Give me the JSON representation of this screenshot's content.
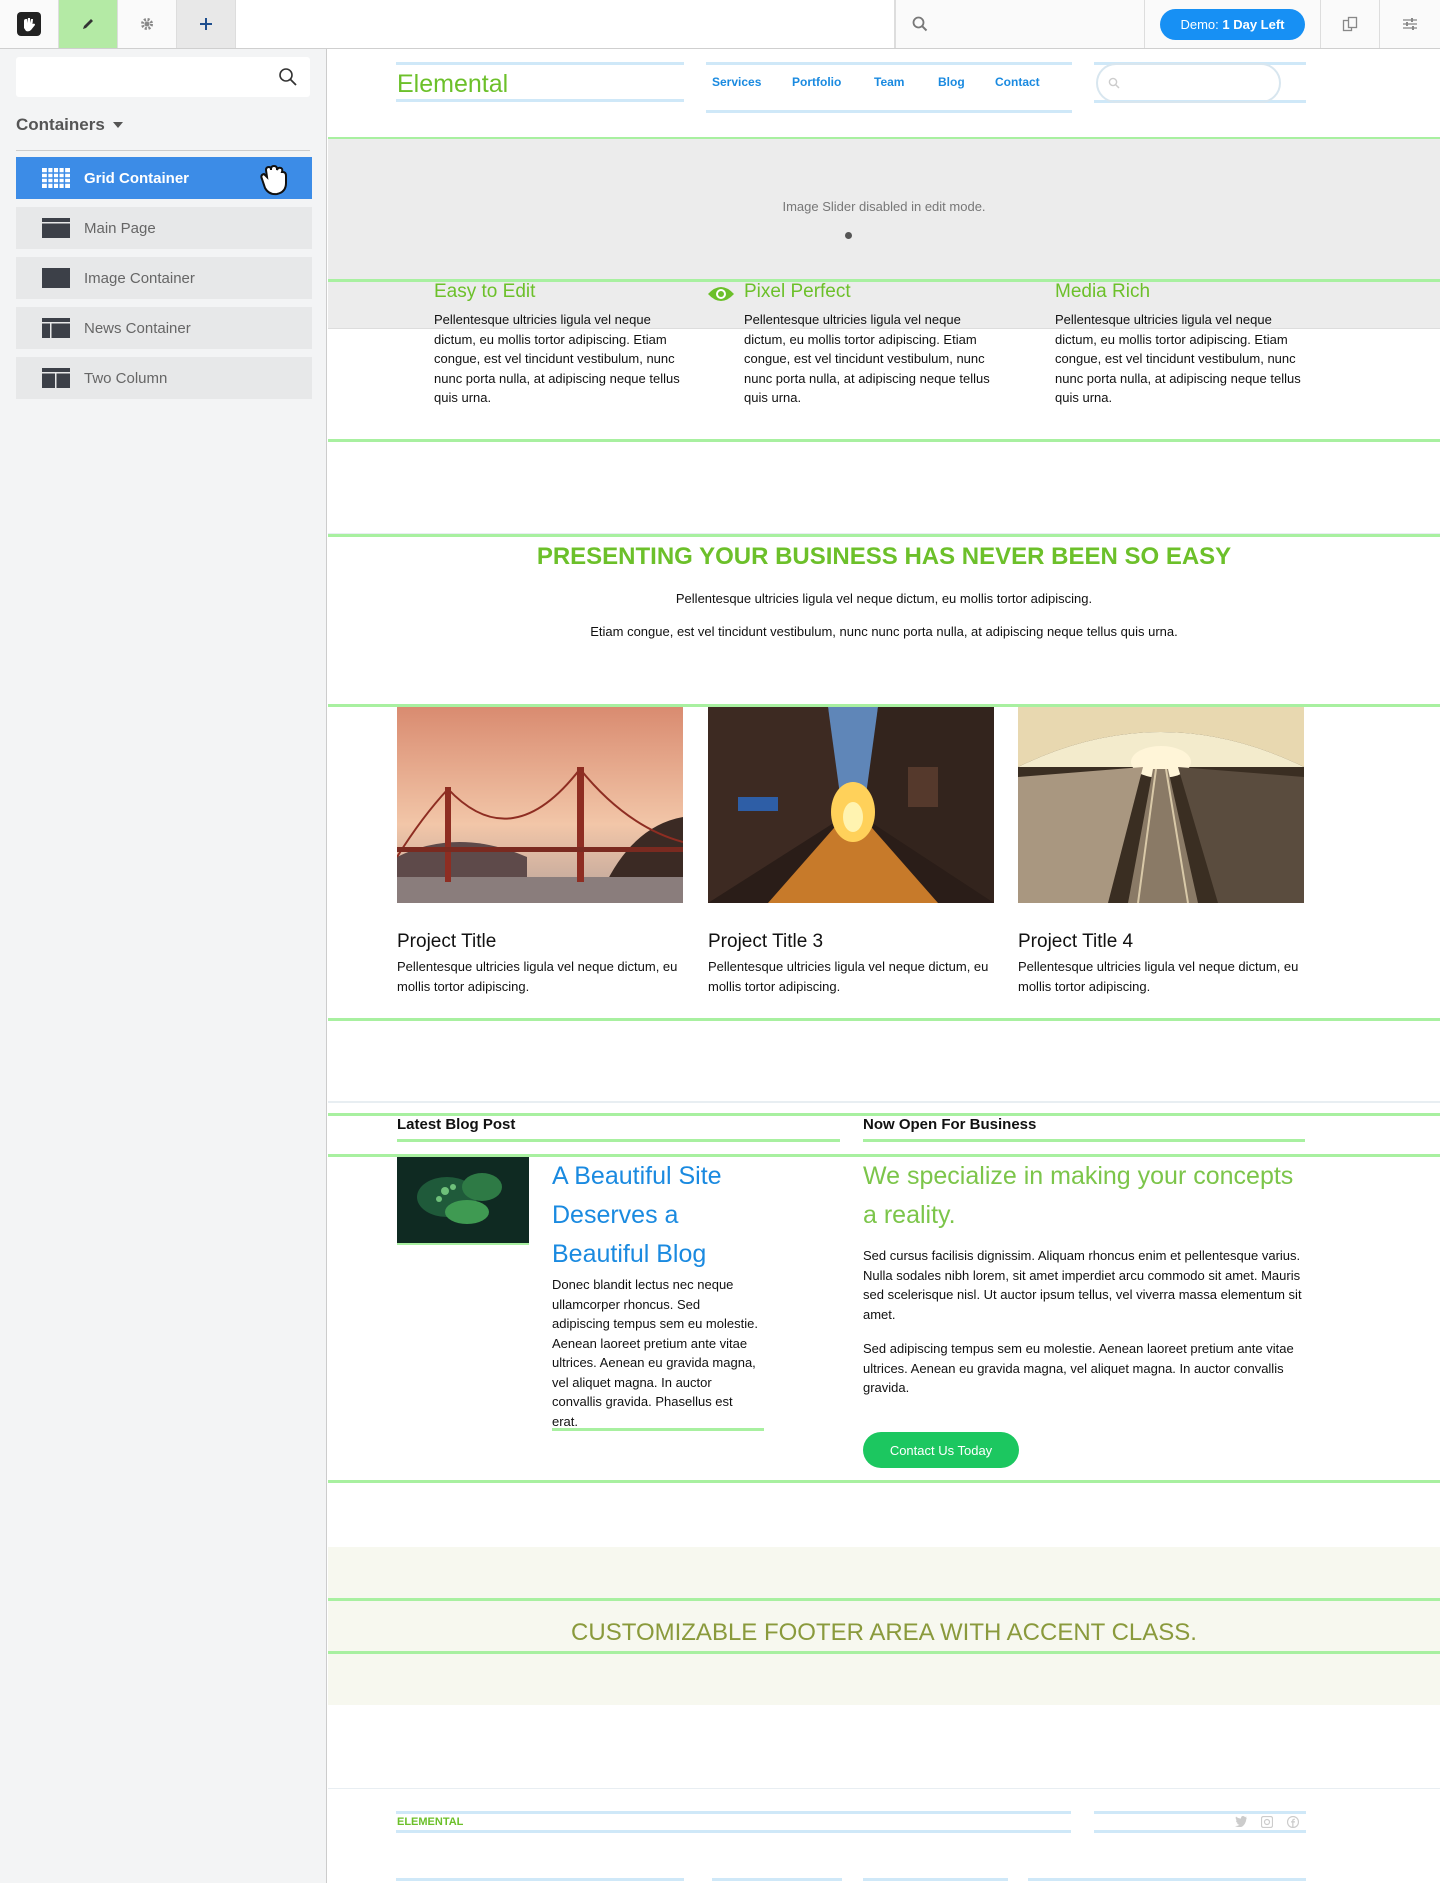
{
  "toolbar": {
    "demo_prefix": "Demo: ",
    "demo_strong": "1 Day Left"
  },
  "sidebar": {
    "heading": "Containers",
    "items": [
      {
        "label": "Grid Container"
      },
      {
        "label": "Main Page"
      },
      {
        "label": "Image Container"
      },
      {
        "label": "News Container"
      },
      {
        "label": "Two Column"
      }
    ]
  },
  "site": {
    "brand": "Elemental",
    "nav": [
      "Services",
      "Portfolio",
      "Team",
      "Blog",
      "Contact"
    ],
    "slider_note": "Image Slider disabled in edit mode.",
    "features": [
      {
        "title": "Easy to Edit",
        "text": "Pellentesque ultricies ligula vel neque dictum, eu mollis tortor adipiscing. Etiam congue, est vel tincidunt vestibulum, nunc nunc porta nulla, at adipiscing neque tellus quis urna."
      },
      {
        "title": "Pixel Perfect",
        "text": "Pellentesque ultricies ligula vel neque dictum, eu mollis tortor adipiscing. Etiam congue, est vel tincidunt vestibulum, nunc nunc porta nulla, at adipiscing neque tellus quis urna."
      },
      {
        "title": "Media Rich",
        "text": "Pellentesque ultricies ligula vel neque dictum, eu mollis tortor adipiscing. Etiam congue, est vel tincidunt vestibulum, nunc nunc porta nulla, at adipiscing neque tellus quis urna."
      }
    ],
    "headline": "PRESENTING YOUR BUSINESS HAS NEVER BEEN SO EASY",
    "headline_p1": "Pellentesque ultricies ligula vel neque dictum, eu mollis tortor adipiscing.",
    "headline_p2": "Etiam congue, est vel tincidunt vestibulum, nunc nunc porta nulla, at adipiscing neque tellus quis urna.",
    "projects": [
      {
        "title": "Project Title",
        "text": "Pellentesque ultricies ligula vel neque dictum, eu mollis tortor adipiscing."
      },
      {
        "title": "Project Title 3",
        "text": "Pellentesque ultricies ligula vel neque dictum, eu mollis tortor adipiscing."
      },
      {
        "title": "Project Title 4",
        "text": "Pellentesque ultricies ligula vel neque dictum, eu mollis tortor adipiscing."
      }
    ],
    "blog_label": "Latest Blog Post",
    "blog_title": "A Beautiful Site Deserves a Beautiful Blog",
    "blog_text": "Donec blandit lectus nec neque ullamcorper rhoncus. Sed adipiscing tempus sem eu molestie. Aenean laoreet pretium ante vitae ultrices. Aenean eu gravida magna, vel aliquet magna. In auctor convallis gravida. Phasellus est erat.",
    "biz_label": "Now Open For Business",
    "biz_title": "We specialize in making your concepts a reality.",
    "biz_p1": "Sed cursus facilisis dignissim. Aliquam rhoncus enim et pellentesque varius. Nulla sodales nibh lorem, sit amet imperdiet arcu commodo sit amet. Mauris sed scelerisque nisl. Ut auctor ipsum tellus, vel viverra massa elementum sit amet.",
    "biz_p2": "Sed adipiscing tempus sem eu molestie. Aenean laoreet pretium ante vitae ultrices. Aenean eu gravida magna, vel aliquet magna. In auctor convallis gravida.",
    "cta": "Contact Us Today",
    "footer_text": "CUSTOMIZABLE FOOTER AREA WITH ACCENT CLASS.",
    "footer_brand": "ELEMENTAL"
  },
  "colors": {
    "brand_green": "#6cc02a",
    "link_blue": "#1a8ae0",
    "toolbar_active": "#b4eaa5",
    "selected_item": "#3c8ce7",
    "cta_green": "#1cc760"
  }
}
